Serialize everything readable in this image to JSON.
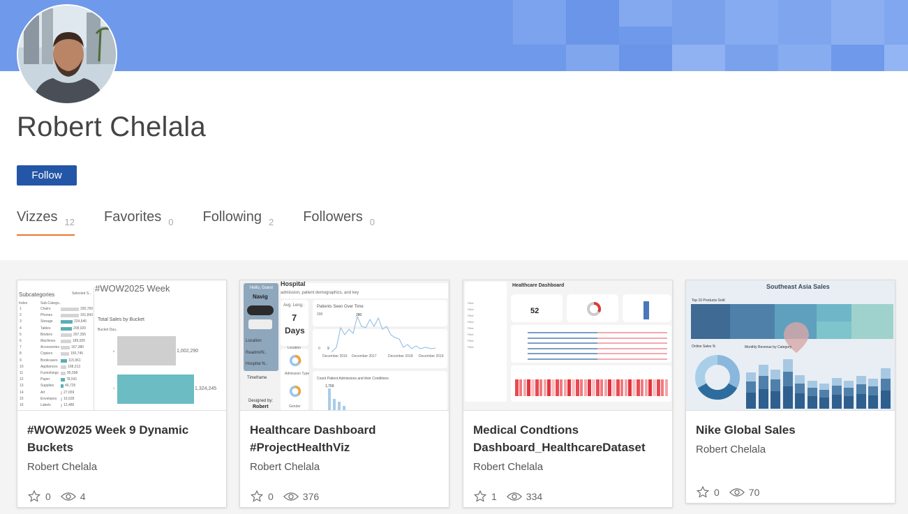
{
  "profile": {
    "name": "Robert Chelala",
    "follow_label": "Follow"
  },
  "tabs": [
    {
      "label": "Vizzes",
      "count": "12"
    },
    {
      "label": "Favorites",
      "count": "0"
    },
    {
      "label": "Following",
      "count": "2"
    },
    {
      "label": "Followers",
      "count": "0"
    }
  ],
  "cards": [
    {
      "title": "#WOW2025 Week 9 Dynamic Buckets",
      "author": "Robert Chelala",
      "favorites": "0",
      "views": "4",
      "thumb": {
        "heading": "#WOW2025 Week",
        "subcat_header": "Subcategories",
        "selected": "Selected S...",
        "col_index": "Index",
        "col_sub": "Sub-Catego..",
        "chart_title": "Total Sales by Bucket",
        "bucket_label": "Bucket Dau..",
        "value_1": "1,002,290",
        "value_2": "1,324,245",
        "rows": [
          {
            "i": "1",
            "name": "Chairs",
            "v": "335,769"
          },
          {
            "i": "2",
            "name": "Phones",
            "v": "331,843"
          },
          {
            "i": "3",
            "name": "Storage",
            "v": "224,645"
          },
          {
            "i": "4",
            "name": "Tables",
            "v": "208,020"
          },
          {
            "i": "5",
            "name": "Binders",
            "v": "207,355"
          },
          {
            "i": "6",
            "name": "Machines",
            "v": "189,925"
          },
          {
            "i": "7",
            "name": "Accessories",
            "v": "167,380"
          },
          {
            "i": "8",
            "name": "Copiers",
            "v": "150,745"
          },
          {
            "i": "9",
            "name": "Bookcases",
            "v": "115,961"
          },
          {
            "i": "10",
            "name": "Appliances",
            "v": "108,213"
          },
          {
            "i": "11",
            "name": "Furnishings",
            "v": "95,598"
          },
          {
            "i": "12",
            "name": "Paper",
            "v": "78,541"
          },
          {
            "i": "13",
            "name": "Supplies",
            "v": "46,725"
          },
          {
            "i": "14",
            "name": "Art",
            "v": "27,659"
          },
          {
            "i": "15",
            "name": "Envelopes",
            "v": "16,528"
          },
          {
            "i": "16",
            "name": "Labels",
            "v": "12,486"
          }
        ]
      }
    },
    {
      "title": "Healthcare Dashboard #ProjectHealthViz",
      "author": "Robert Chelala",
      "favorites": "0",
      "views": "376",
      "thumb": {
        "hello": "Hello, Guest",
        "navig": "Navig",
        "hospital": "Hospital",
        "subtitle": "admission, patient demographics, and key",
        "avg_label": "Avg. Leng..",
        "avg_value": "7",
        "avg_unit": "Days",
        "location": "Location",
        "patients_title": "Patients Seen Over Time",
        "peak": "280",
        "low": "9",
        "y_200": "200",
        "y_0": "0",
        "x_labels": [
          "December 2016",
          "December 2017",
          "December 2018",
          "December 2019"
        ],
        "admissions_title": "Count Patient Admissions and their Conditions",
        "adm_value": "1,769",
        "timeframe": "Timeframe",
        "designed_by": "Designed by:",
        "designer": "Robert",
        "gender": "Gender",
        "admission_type": "Admission Type"
      }
    },
    {
      "title": "Medical Condtions Dashboard_HealthcareDataset",
      "author": "Robert Chelala",
      "favorites": "1",
      "views": "334",
      "thumb": {
        "heading": "Healthcare Dashboard",
        "kpi": "52"
      }
    },
    {
      "title": "Nike Global Sales",
      "author": "Robert Chelala",
      "favorites": "0",
      "views": "70",
      "thumb": {
        "heading": "Southeast Asia Sales",
        "top10": "Top 10 Products Sold",
        "online": "Online Sales %",
        "monthly": "Monthly Revenue by Category"
      }
    }
  ],
  "colors": {
    "banner": "#6f99ea",
    "follow": "#2356a6",
    "tab_underline": "#e8762d"
  }
}
